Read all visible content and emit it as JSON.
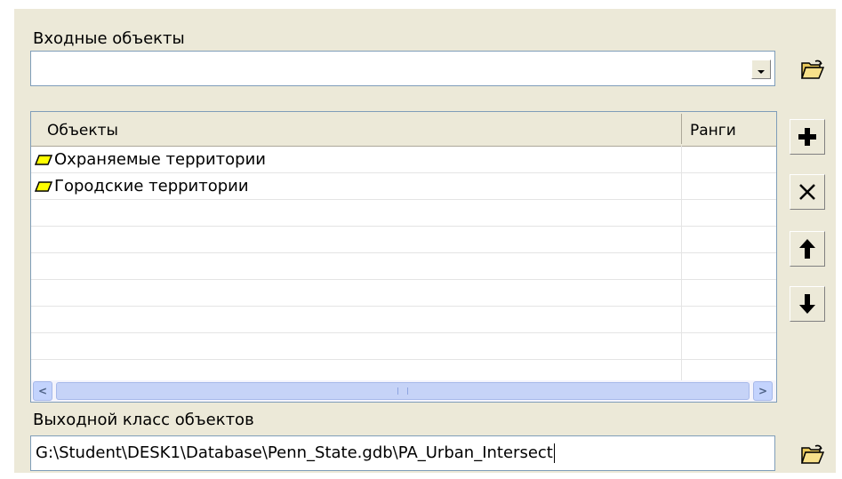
{
  "input_section": {
    "label": "Входные объекты",
    "combo_value": ""
  },
  "table": {
    "columns": [
      "Объекты",
      "Ранги"
    ],
    "rows": [
      {
        "name": "Охраняемые территории",
        "rank": "",
        "icon": "polygon-layer-icon"
      },
      {
        "name": "Городские территории",
        "rank": "",
        "icon": "polygon-layer-icon"
      }
    ],
    "empty_rows": 7,
    "scroll_left": "<",
    "scroll_right": ">"
  },
  "side_buttons": [
    "open-folder-icon",
    "add-icon",
    "remove-icon",
    "move-up-icon",
    "move-down-icon"
  ],
  "output_section": {
    "label": "Выходной класс объектов",
    "value": "G:\\Student\\DESK1\\Database\\Penn_State.gdb\\PA_Urban_Intersect"
  },
  "colors": {
    "panel": "#ece9d8",
    "field_border": "#7f9db9",
    "polygon_icon_fill": "#ffff00"
  }
}
